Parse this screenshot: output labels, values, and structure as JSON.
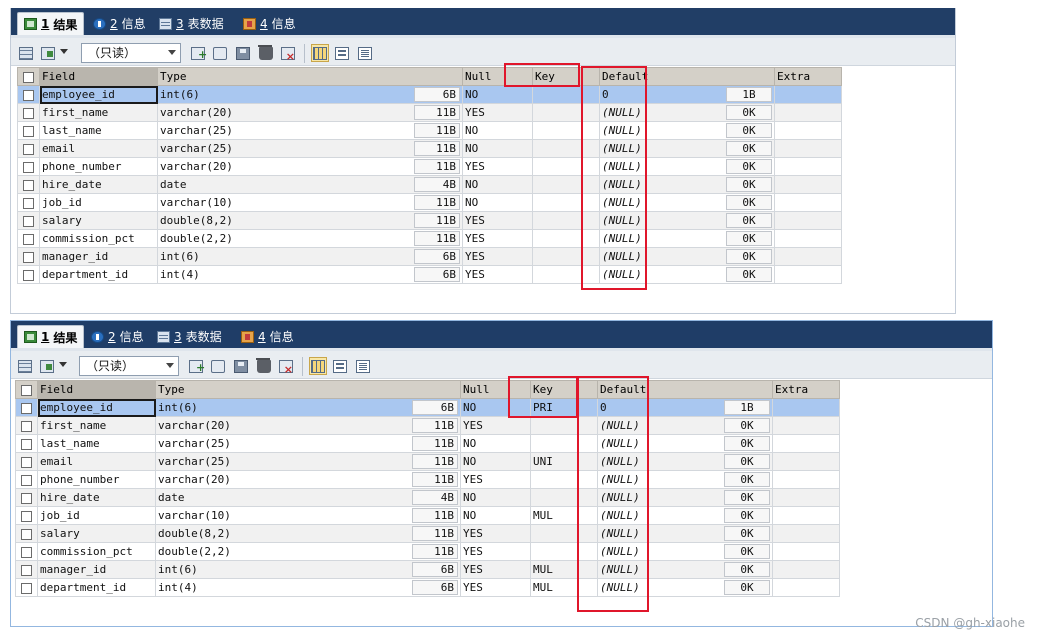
{
  "tabs": [
    {
      "num": "1",
      "label": "结果",
      "icon": "result-grid-icon",
      "active": true
    },
    {
      "num": "2",
      "label": "信息",
      "icon": "info-icon",
      "active": false
    },
    {
      "num": "3",
      "label": "表数据",
      "icon": "table-data-icon",
      "active": false
    },
    {
      "num": "4",
      "label": "信息",
      "icon": "info-chart-icon",
      "active": false
    }
  ],
  "toolbar": {
    "mode_select": "（只读）",
    "icons": [
      "grid-options-icon",
      "export-icon",
      "add-row-icon",
      "duplicate-row-icon",
      "save-icon",
      "delete-icon",
      "cancel-icon",
      "grid-view-icon",
      "form-view-icon",
      "text-view-icon"
    ]
  },
  "columns": {
    "field": "Field",
    "type": "Type",
    "null": "Null",
    "key": "Key",
    "default": "Default",
    "extra": "Extra"
  },
  "panels": [
    {
      "rows": [
        {
          "field": "employee_id",
          "type": "int(6)",
          "size": "6B",
          "null": "NO",
          "key": "",
          "default": "0",
          "dsize": "1B",
          "extra": ""
        },
        {
          "field": "first_name",
          "type": "varchar(20)",
          "size": "11B",
          "null": "YES",
          "key": "",
          "default": "(NULL)",
          "dsize": "0K",
          "extra": ""
        },
        {
          "field": "last_name",
          "type": "varchar(25)",
          "size": "11B",
          "null": "NO",
          "key": "",
          "default": "(NULL)",
          "dsize": "0K",
          "extra": ""
        },
        {
          "field": "email",
          "type": "varchar(25)",
          "size": "11B",
          "null": "NO",
          "key": "",
          "default": "(NULL)",
          "dsize": "0K",
          "extra": ""
        },
        {
          "field": "phone_number",
          "type": "varchar(20)",
          "size": "11B",
          "null": "YES",
          "key": "",
          "default": "(NULL)",
          "dsize": "0K",
          "extra": ""
        },
        {
          "field": "hire_date",
          "type": "date",
          "size": "4B",
          "null": "NO",
          "key": "",
          "default": "(NULL)",
          "dsize": "0K",
          "extra": ""
        },
        {
          "field": "job_id",
          "type": "varchar(10)",
          "size": "11B",
          "null": "NO",
          "key": "",
          "default": "(NULL)",
          "dsize": "0K",
          "extra": ""
        },
        {
          "field": "salary",
          "type": "double(8,2)",
          "size": "11B",
          "null": "YES",
          "key": "",
          "default": "(NULL)",
          "dsize": "0K",
          "extra": ""
        },
        {
          "field": "commission_pct",
          "type": "double(2,2)",
          "size": "11B",
          "null": "YES",
          "key": "",
          "default": "(NULL)",
          "dsize": "0K",
          "extra": ""
        },
        {
          "field": "manager_id",
          "type": "int(6)",
          "size": "6B",
          "null": "YES",
          "key": "",
          "default": "(NULL)",
          "dsize": "0K",
          "extra": ""
        },
        {
          "field": "department_id",
          "type": "int(4)",
          "size": "6B",
          "null": "YES",
          "key": "",
          "default": "(NULL)",
          "dsize": "0K",
          "extra": ""
        }
      ]
    },
    {
      "rows": [
        {
          "field": "employee_id",
          "type": "int(6)",
          "size": "6B",
          "null": "NO",
          "key": "PRI",
          "default": "0",
          "dsize": "1B",
          "extra": ""
        },
        {
          "field": "first_name",
          "type": "varchar(20)",
          "size": "11B",
          "null": "YES",
          "key": "",
          "default": "(NULL)",
          "dsize": "0K",
          "extra": ""
        },
        {
          "field": "last_name",
          "type": "varchar(25)",
          "size": "11B",
          "null": "NO",
          "key": "",
          "default": "(NULL)",
          "dsize": "0K",
          "extra": ""
        },
        {
          "field": "email",
          "type": "varchar(25)",
          "size": "11B",
          "null": "NO",
          "key": "UNI",
          "default": "(NULL)",
          "dsize": "0K",
          "extra": ""
        },
        {
          "field": "phone_number",
          "type": "varchar(20)",
          "size": "11B",
          "null": "YES",
          "key": "",
          "default": "(NULL)",
          "dsize": "0K",
          "extra": ""
        },
        {
          "field": "hire_date",
          "type": "date",
          "size": "4B",
          "null": "NO",
          "key": "",
          "default": "(NULL)",
          "dsize": "0K",
          "extra": ""
        },
        {
          "field": "job_id",
          "type": "varchar(10)",
          "size": "11B",
          "null": "NO",
          "key": "MUL",
          "default": "(NULL)",
          "dsize": "0K",
          "extra": ""
        },
        {
          "field": "salary",
          "type": "double(8,2)",
          "size": "11B",
          "null": "YES",
          "key": "",
          "default": "(NULL)",
          "dsize": "0K",
          "extra": ""
        },
        {
          "field": "commission_pct",
          "type": "double(2,2)",
          "size": "11B",
          "null": "YES",
          "key": "",
          "default": "(NULL)",
          "dsize": "0K",
          "extra": ""
        },
        {
          "field": "manager_id",
          "type": "int(6)",
          "size": "6B",
          "null": "YES",
          "key": "MUL",
          "default": "(NULL)",
          "dsize": "0K",
          "extra": ""
        },
        {
          "field": "department_id",
          "type": "int(4)",
          "size": "6B",
          "null": "YES",
          "key": "MUL",
          "default": "(NULL)",
          "dsize": "0K",
          "extra": ""
        }
      ]
    }
  ],
  "annotation_color": "#e0162b",
  "watermark": "CSDN @gh-xiaohe"
}
